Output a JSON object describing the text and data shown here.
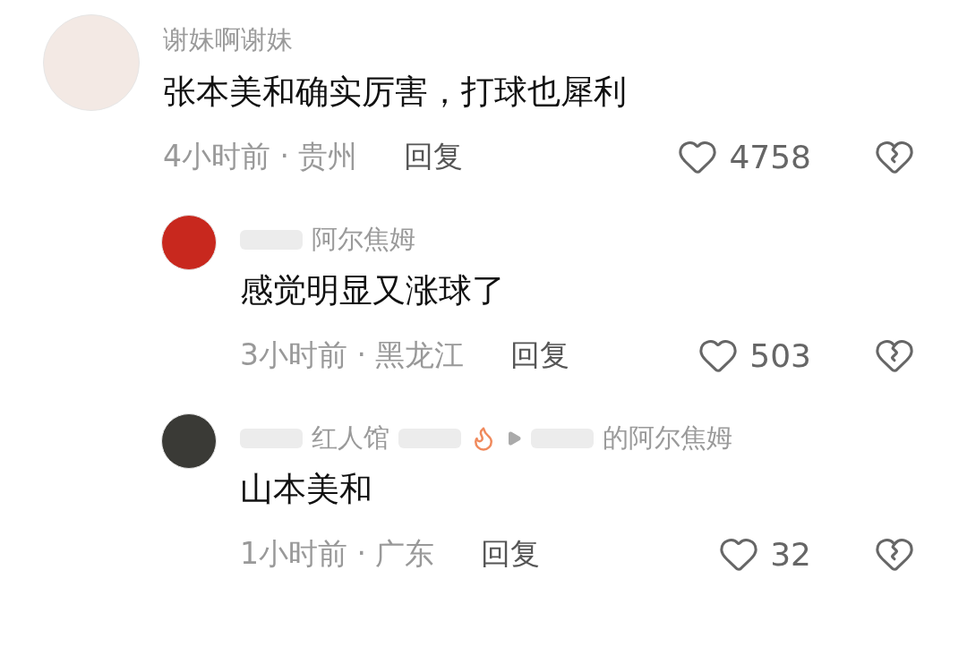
{
  "comments": [
    {
      "author": "谢妹啊谢妹",
      "text": "张本美和确实厉害，打球也犀利",
      "time_location": "4小时前 · 贵州",
      "reply_label": "回复",
      "likes": "4758",
      "replies": [
        {
          "author": "阿尔焦姆",
          "text": "感觉明显又涨球了",
          "time_location": "3小时前 · 黑龙江",
          "reply_label": "回复",
          "likes": "503"
        },
        {
          "author": "红人馆",
          "reply_to": "的阿尔焦姆",
          "text": "山本美和",
          "time_location": "1小时前 · 广东",
          "reply_label": "回复",
          "likes": "32"
        }
      ]
    }
  ]
}
